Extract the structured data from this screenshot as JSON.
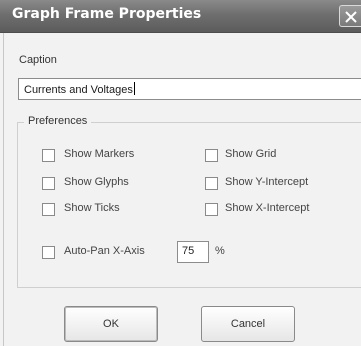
{
  "window": {
    "title": "Graph Frame Properties"
  },
  "caption": {
    "label": "Caption",
    "value": "Currents and Voltages"
  },
  "preferences": {
    "legend": "Preferences",
    "options": [
      {
        "label": "Show Markers",
        "checked": false
      },
      {
        "label": "Show Grid",
        "checked": false
      },
      {
        "label": "Show Glyphs",
        "checked": false
      },
      {
        "label": "Show Y-Intercept",
        "checked": false
      },
      {
        "label": "Show Ticks",
        "checked": false
      },
      {
        "label": "Show X-Intercept",
        "checked": false
      }
    ],
    "auto_pan": {
      "label": "Auto-Pan X-Axis",
      "checked": false,
      "value": "75",
      "unit": "%"
    }
  },
  "buttons": {
    "ok": "OK",
    "cancel": "Cancel"
  },
  "colors": {
    "titlebar": "#6e6e6e",
    "dialog_bg": "#f2f2f2"
  }
}
